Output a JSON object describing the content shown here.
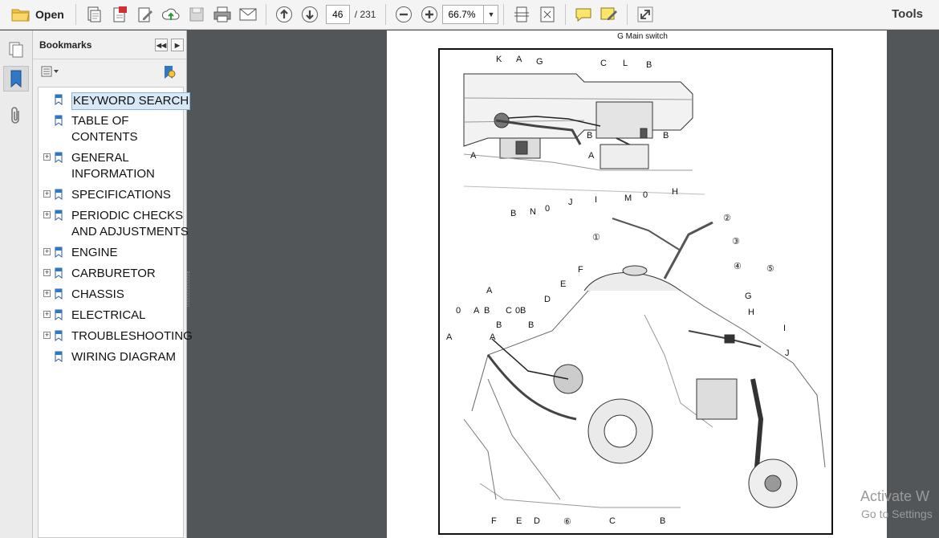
{
  "toolbar": {
    "open_label": "Open",
    "current_page": "46",
    "total_pages": "/ 231",
    "zoom": "66.7%",
    "tools_label": "Tools"
  },
  "bookmarks": {
    "title": "Bookmarks",
    "items": [
      {
        "label": "KEYWORD SEARCH",
        "expandable": false,
        "selected": true
      },
      {
        "label": "TABLE OF",
        "label2": "CONTENTS",
        "expandable": false
      },
      {
        "label": "GENERAL",
        "label2": "INFORMATION",
        "expandable": true
      },
      {
        "label": "SPECIFICATIONS",
        "expandable": true
      },
      {
        "label": "PERIODIC CHECKS",
        "label2": "AND ADJUSTMENTS",
        "expandable": true
      },
      {
        "label": "ENGINE",
        "expandable": true
      },
      {
        "label": "CARBURETOR",
        "expandable": true
      },
      {
        "label": "CHASSIS",
        "expandable": true
      },
      {
        "label": "ELECTRICAL",
        "expandable": true
      },
      {
        "label": "TROUBLESHOOTING",
        "expandable": true
      },
      {
        "label": "WIRING DIAGRAM",
        "expandable": false
      }
    ]
  },
  "document": {
    "page_heading": "G   Main switch",
    "top_labels": [
      "K",
      "A",
      "G",
      "C",
      "L",
      "B",
      "B",
      "B",
      "A",
      "A",
      "B",
      "N",
      "0",
      "J",
      "I",
      "M",
      "0",
      "H"
    ],
    "main_labels": [
      "A",
      "0",
      "A",
      "B",
      "C",
      "0",
      "B",
      "B",
      "B",
      "A",
      "A",
      "D",
      "E",
      "F",
      "G",
      "H",
      "I",
      "J",
      "F",
      "E",
      "D",
      "C",
      "B",
      "①",
      "②",
      "③",
      "④",
      "⑤",
      "⑥"
    ]
  },
  "watermark": {
    "line1": "Activate W",
    "line2": "Go to Settings"
  },
  "colors": {
    "toolbar_bg": "#f4f4f4",
    "viewer_bg": "#525659",
    "selection_bg": "#d7e8f7"
  }
}
